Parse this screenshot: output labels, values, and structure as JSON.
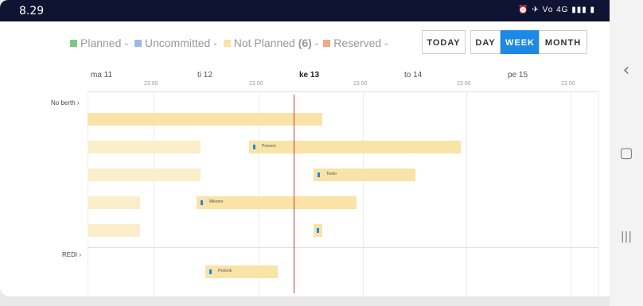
{
  "status": {
    "time": "8.29",
    "icons": "⏰ ✈ Vo 4G ▮▮▮ ▮"
  },
  "legend": {
    "items": [
      {
        "label": "Planned -",
        "color": "#7fc97f"
      },
      {
        "label": "Uncommitted -",
        "color": "#9cb9e8"
      },
      {
        "label": "Not Planned",
        "count": "(6)",
        "color": "#f9e3a7"
      },
      {
        "label": "Reserved -",
        "color": "#f0a88c"
      }
    ]
  },
  "toolbar": {
    "today": "TODAY",
    "day": "DAY",
    "week": "WEEK",
    "month": "MONTH",
    "active_view": "week"
  },
  "timeline": {
    "days": [
      "ma 11",
      "ti 12",
      "ke 13",
      "to 14",
      "pe 15"
    ],
    "current_day": "ke 13",
    "time_ticks": [
      "23 00",
      "23 00",
      "23 00",
      "23 00",
      "23 00"
    ]
  },
  "sections": [
    {
      "label": "No berth",
      "chevron": "›"
    },
    {
      "label": "REDI",
      "chevron": "›"
    }
  ],
  "bars": [
    {
      "label": ""
    },
    {
      "label": ""
    },
    {
      "label": "Poisson"
    },
    {
      "label": ""
    },
    {
      "label": "Tesko"
    },
    {
      "label": ""
    },
    {
      "label": "Mikomo"
    },
    {
      "label": ""
    },
    {
      "label": ""
    },
    {
      "label": "Pertorik"
    }
  ],
  "nav": {
    "back": "‹",
    "home": "▢",
    "recents": "|||"
  },
  "colors": {
    "accent": "#1e88e5",
    "now_line": "#d23b3b",
    "not_planned": "#f9e3a7"
  }
}
